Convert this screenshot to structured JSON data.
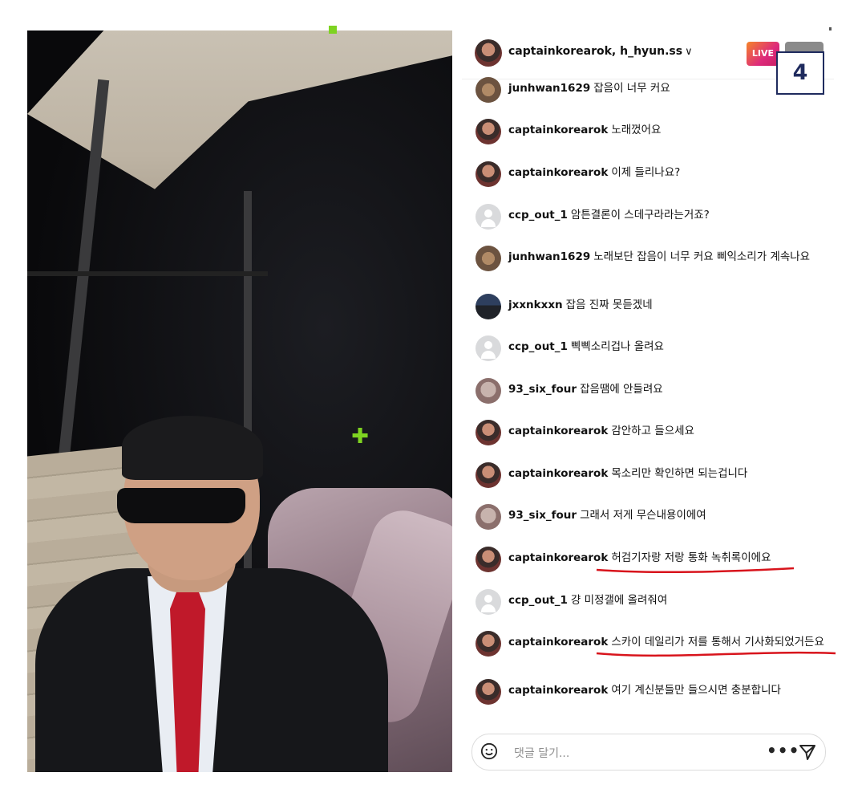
{
  "stream": {
    "header_users": "captainkorearok, h_hyun.ss",
    "chevron": "∨",
    "live_label": "LIVE",
    "badge_number": "4"
  },
  "comments": [
    {
      "user": "junhwan1629",
      "text": "잡음이 너무 커요",
      "avatar": "brown"
    },
    {
      "user": "captainkorearok",
      "text": "노래껐어요",
      "avatar": "host"
    },
    {
      "user": "captainkorearok",
      "text": "이제 들리나요?",
      "avatar": "host"
    },
    {
      "user": "ccp_out_1",
      "text": "암튼결론이 스데구라라는거죠?",
      "avatar": "gray"
    },
    {
      "user": "junhwan1629",
      "text": "노래보단 잡음이 너무 커요 삐익소리가 계속나요",
      "avatar": "brown"
    },
    {
      "user": "jxxnkxxn",
      "text": "잡음 진짜 못듣겠네",
      "avatar": "scene"
    },
    {
      "user": "ccp_out_1",
      "text": "삑삑소리겁나 올려요",
      "avatar": "gray"
    },
    {
      "user": "93_six_four",
      "text": "잡음땜에 안들려요",
      "avatar": "beige"
    },
    {
      "user": "captainkorearok",
      "text": "감안하고 들으세요",
      "avatar": "host"
    },
    {
      "user": "captainkorearok",
      "text": "목소리만 확인하면 되는겁니다",
      "avatar": "host"
    },
    {
      "user": "93_six_four",
      "text": "그래서 저게 무슨내용이에여",
      "avatar": "beige"
    },
    {
      "user": "captainkorearok",
      "text": "허검기자랑 저랑 통화 녹취록이에요",
      "avatar": "host"
    },
    {
      "user": "ccp_out_1",
      "text": "걍 미정갤에 올려줘여",
      "avatar": "gray"
    },
    {
      "user": "captainkorearok",
      "text": "스카이 데일리가 저를 통해서 기사화되었거든요",
      "avatar": "host"
    },
    {
      "user": "captainkorearok",
      "text": "여기 계신분들만 들으시면 충분합니다",
      "avatar": "host"
    }
  ],
  "composer": {
    "placeholder": "댓글 달기...",
    "more_label": "•••"
  },
  "colors": {
    "live_gradient_start": "#f58529",
    "live_gradient_end": "#dd2a7b",
    "annotation_red": "#d8141c",
    "badge_border": "#1f2b5e",
    "move_cursor": "#7ed321"
  },
  "icons": {
    "move_cursor": "move-cursor-icon",
    "emoji": "smiley-icon",
    "send": "send-icon"
  }
}
